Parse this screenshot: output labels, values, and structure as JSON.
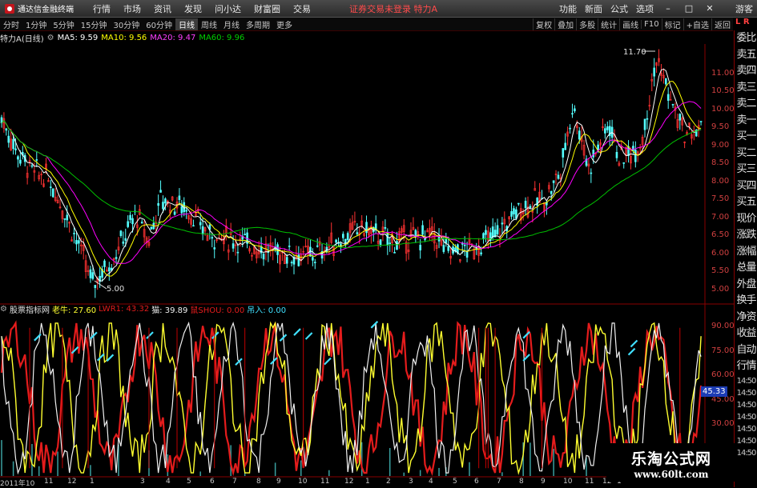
{
  "app": {
    "title": "通达信金融终端"
  },
  "menu": [
    "行情",
    "市场",
    "资讯",
    "发现",
    "问小达",
    "财富圈",
    "交易"
  ],
  "trade_status": "证券交易未登录 特力A",
  "right_menu": [
    "功能",
    "新面",
    "公式",
    "选项"
  ],
  "guest": "游客",
  "timeframes": [
    "分时",
    "1分钟",
    "5分钟",
    "15分钟",
    "30分钟",
    "60分钟",
    "日线",
    "周线",
    "月线",
    "多周期",
    "更多"
  ],
  "active_timeframe": "日线",
  "toolbar_right": [
    "复权",
    "叠加",
    "多股",
    "统计",
    "画线",
    "F10",
    "标记",
    "+自选",
    "返回"
  ],
  "lr_badge": "L R",
  "ma_header": {
    "stock": "特力A(日线)",
    "ma5": "MA5: 9.59",
    "ma10": "MA10: 9.56",
    "ma20": "MA20: 9.47",
    "ma60": "MA60: 9.96"
  },
  "price_labels": {
    "high": "11.70",
    "low": "5.00"
  },
  "yaxis_main": [
    "11.00",
    "10.50",
    "10.00",
    "9.50",
    "9.00",
    "8.50",
    "8.00",
    "7.50",
    "7.00",
    "6.50",
    "6.00",
    "5.50",
    "5.00"
  ],
  "indicator_header": {
    "name": "股票指标网",
    "laomu": "老牛: 27.60",
    "lwr1": "LWR1: 43.32",
    "mao": "猫: 39.89",
    "shou": "鼠SHOU: 0.00",
    "buy": "吊入: 0.00"
  },
  "yaxis_ind": [
    "90.00",
    "75.00",
    "60.00",
    "45.00",
    "30.00"
  ],
  "price_tag": "45.33",
  "right_panel": [
    "委比",
    "卖五",
    "卖四",
    "卖三",
    "卖二",
    "卖一",
    "买一",
    "买二",
    "买三",
    "买四",
    "买五",
    "现价",
    "涨跌",
    "涨幅",
    "总量",
    "外盘",
    "换手",
    "净资",
    "收益",
    "自动",
    "行情",
    "14:50",
    "14:50",
    "14:50",
    "14:50",
    "14:50",
    "14:50",
    "14:50"
  ],
  "date_axis": [
    "2011年10",
    "11",
    "12",
    "1",
    "3",
    "4",
    "5",
    "6",
    "7",
    "8",
    "9",
    "10",
    "11",
    "12",
    "1",
    "2",
    "3",
    "4",
    "5",
    "6",
    "7",
    "8",
    "9",
    "10",
    "11",
    "12",
    "1"
  ],
  "watermark": {
    "title": "乐淘公式网",
    "url": "www.60lt.com"
  },
  "colors": {
    "ma5": "#ffffff",
    "ma10": "#ffff00",
    "ma20": "#ff00ff",
    "ma60": "#00c000",
    "up": "#ff3232",
    "down": "#54ffff",
    "ind_red": "#e41c1c",
    "ind_yellow": "#ffff30",
    "ind_white": "#f0f0f0",
    "ind_cyan": "#40e0ff",
    "axis": "#d04040"
  }
}
